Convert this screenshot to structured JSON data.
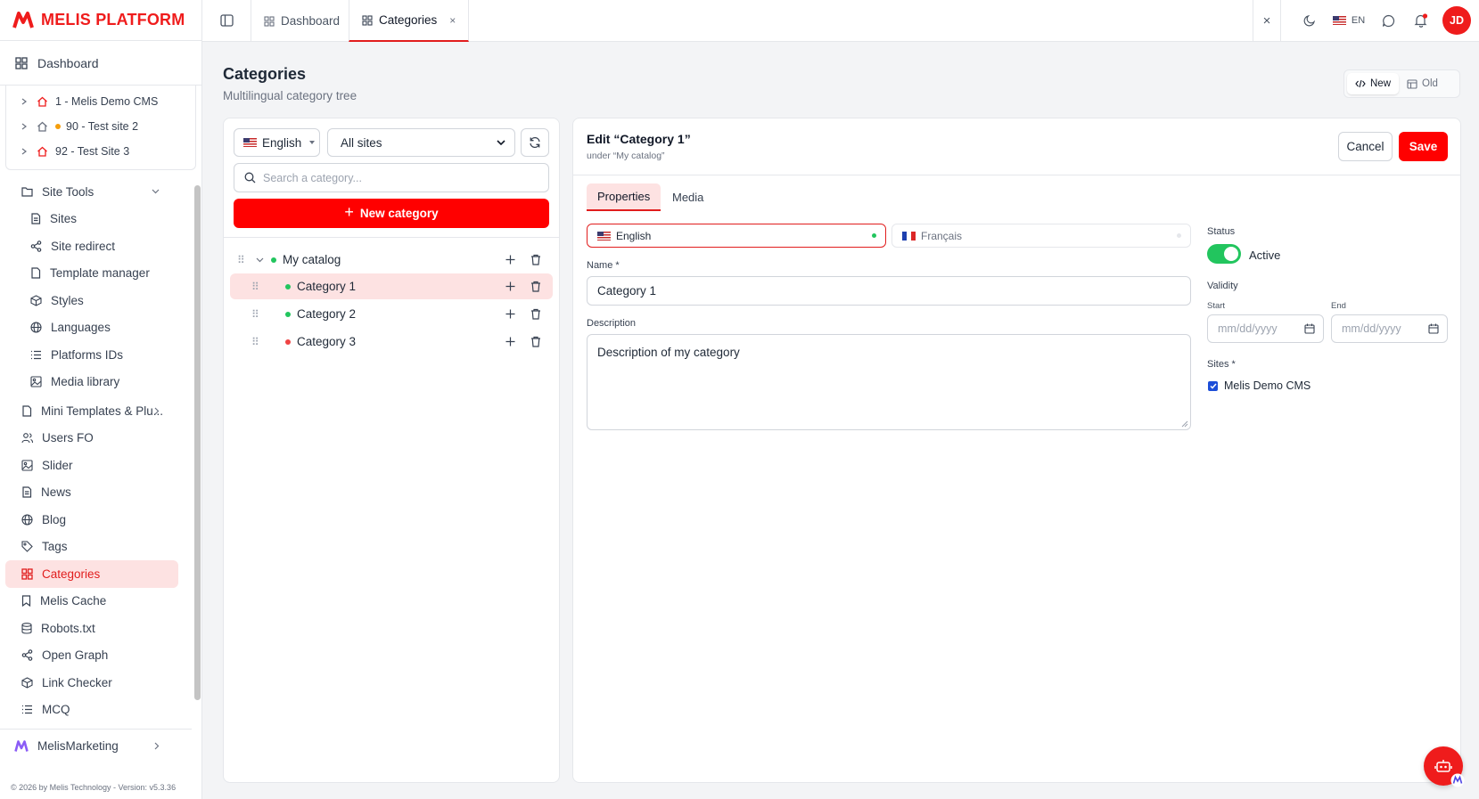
{
  "brand": {
    "name": "MELIS PLATFORM",
    "color": "#ef1c1c"
  },
  "sidebar": {
    "dashboard_label": "Dashboard",
    "sites": [
      {
        "label": "1 - Melis Demo CMS",
        "house": "red",
        "status": ""
      },
      {
        "label": "90 - Test site 2",
        "house": "gray",
        "status": "orange"
      },
      {
        "label": "92 - Test Site 3",
        "house": "red",
        "status": ""
      }
    ],
    "site_tools": {
      "label": "Site Tools",
      "items": [
        {
          "label": "Sites",
          "icon": "file-icon"
        },
        {
          "label": "Site redirect",
          "icon": "share-icon"
        },
        {
          "label": "Template manager",
          "icon": "file-icon"
        },
        {
          "label": "Styles",
          "icon": "cube-icon"
        },
        {
          "label": "Languages",
          "icon": "globe-icon"
        },
        {
          "label": "Platforms IDs",
          "icon": "list-icon"
        },
        {
          "label": "Media library",
          "icon": "image-icon"
        }
      ]
    },
    "items": [
      {
        "label": "Mini Templates & Plu...",
        "icon": "file-icon"
      },
      {
        "label": "Users FO",
        "icon": "users-icon"
      },
      {
        "label": "Slider",
        "icon": "image-icon"
      },
      {
        "label": "News",
        "icon": "news-icon"
      },
      {
        "label": "Blog",
        "icon": "globe-icon"
      },
      {
        "label": "Tags",
        "icon": "tag-icon"
      },
      {
        "label": "Categories",
        "icon": "grid-icon",
        "active": true
      },
      {
        "label": "Melis Cache",
        "icon": "bookmark-icon"
      },
      {
        "label": "Robots.txt",
        "icon": "database-icon"
      },
      {
        "label": "Open Graph",
        "icon": "share-icon"
      },
      {
        "label": "Link Checker",
        "icon": "cube-icon"
      },
      {
        "label": "MCQ",
        "icon": "list-icon"
      }
    ],
    "marketing_label": "MelisMarketing",
    "footer": "© 2026 by Melis Technology - Version: v5.3.36"
  },
  "topbar": {
    "tabs": [
      {
        "label": "Dashboard"
      },
      {
        "label": "Categories",
        "close": "×"
      }
    ],
    "lang": "EN",
    "close_symbol": "×",
    "avatar_initials": "JD"
  },
  "page": {
    "title": "Categories",
    "subtitle": "Multilingual category tree",
    "view_new": "New",
    "view_old": "Old"
  },
  "tree_panel": {
    "language": "English",
    "site_filter": "All sites",
    "search_placeholder": "Search a category...",
    "new_button": "New category",
    "nodes": [
      {
        "label": "My catalog",
        "status_color": "#22c55e",
        "level": 0
      },
      {
        "label": "Category 1",
        "status_color": "#22c55e",
        "level": 1,
        "selected": true
      },
      {
        "label": "Category 2",
        "status_color": "#22c55e",
        "level": 1
      },
      {
        "label": "Category 3",
        "status_color": "#ef4444",
        "level": 1
      }
    ]
  },
  "editor": {
    "title": "Edit “Category 1”",
    "subtitle": "under “My catalog”",
    "cancel": "Cancel",
    "save": "Save",
    "tabs": [
      "Properties",
      "Media"
    ],
    "languages": [
      "English",
      "Français"
    ],
    "name_label": "Name *",
    "name_value": "Category 1",
    "description_label": "Description",
    "description_value": "Description of my category",
    "status_label": "Status",
    "status_value": "Active",
    "validity_label": "Validity",
    "start_label": "Start",
    "end_label": "End",
    "date_placeholder": "mm/dd/yyyy",
    "sites_label": "Sites *",
    "site_option": "Melis Demo CMS"
  }
}
